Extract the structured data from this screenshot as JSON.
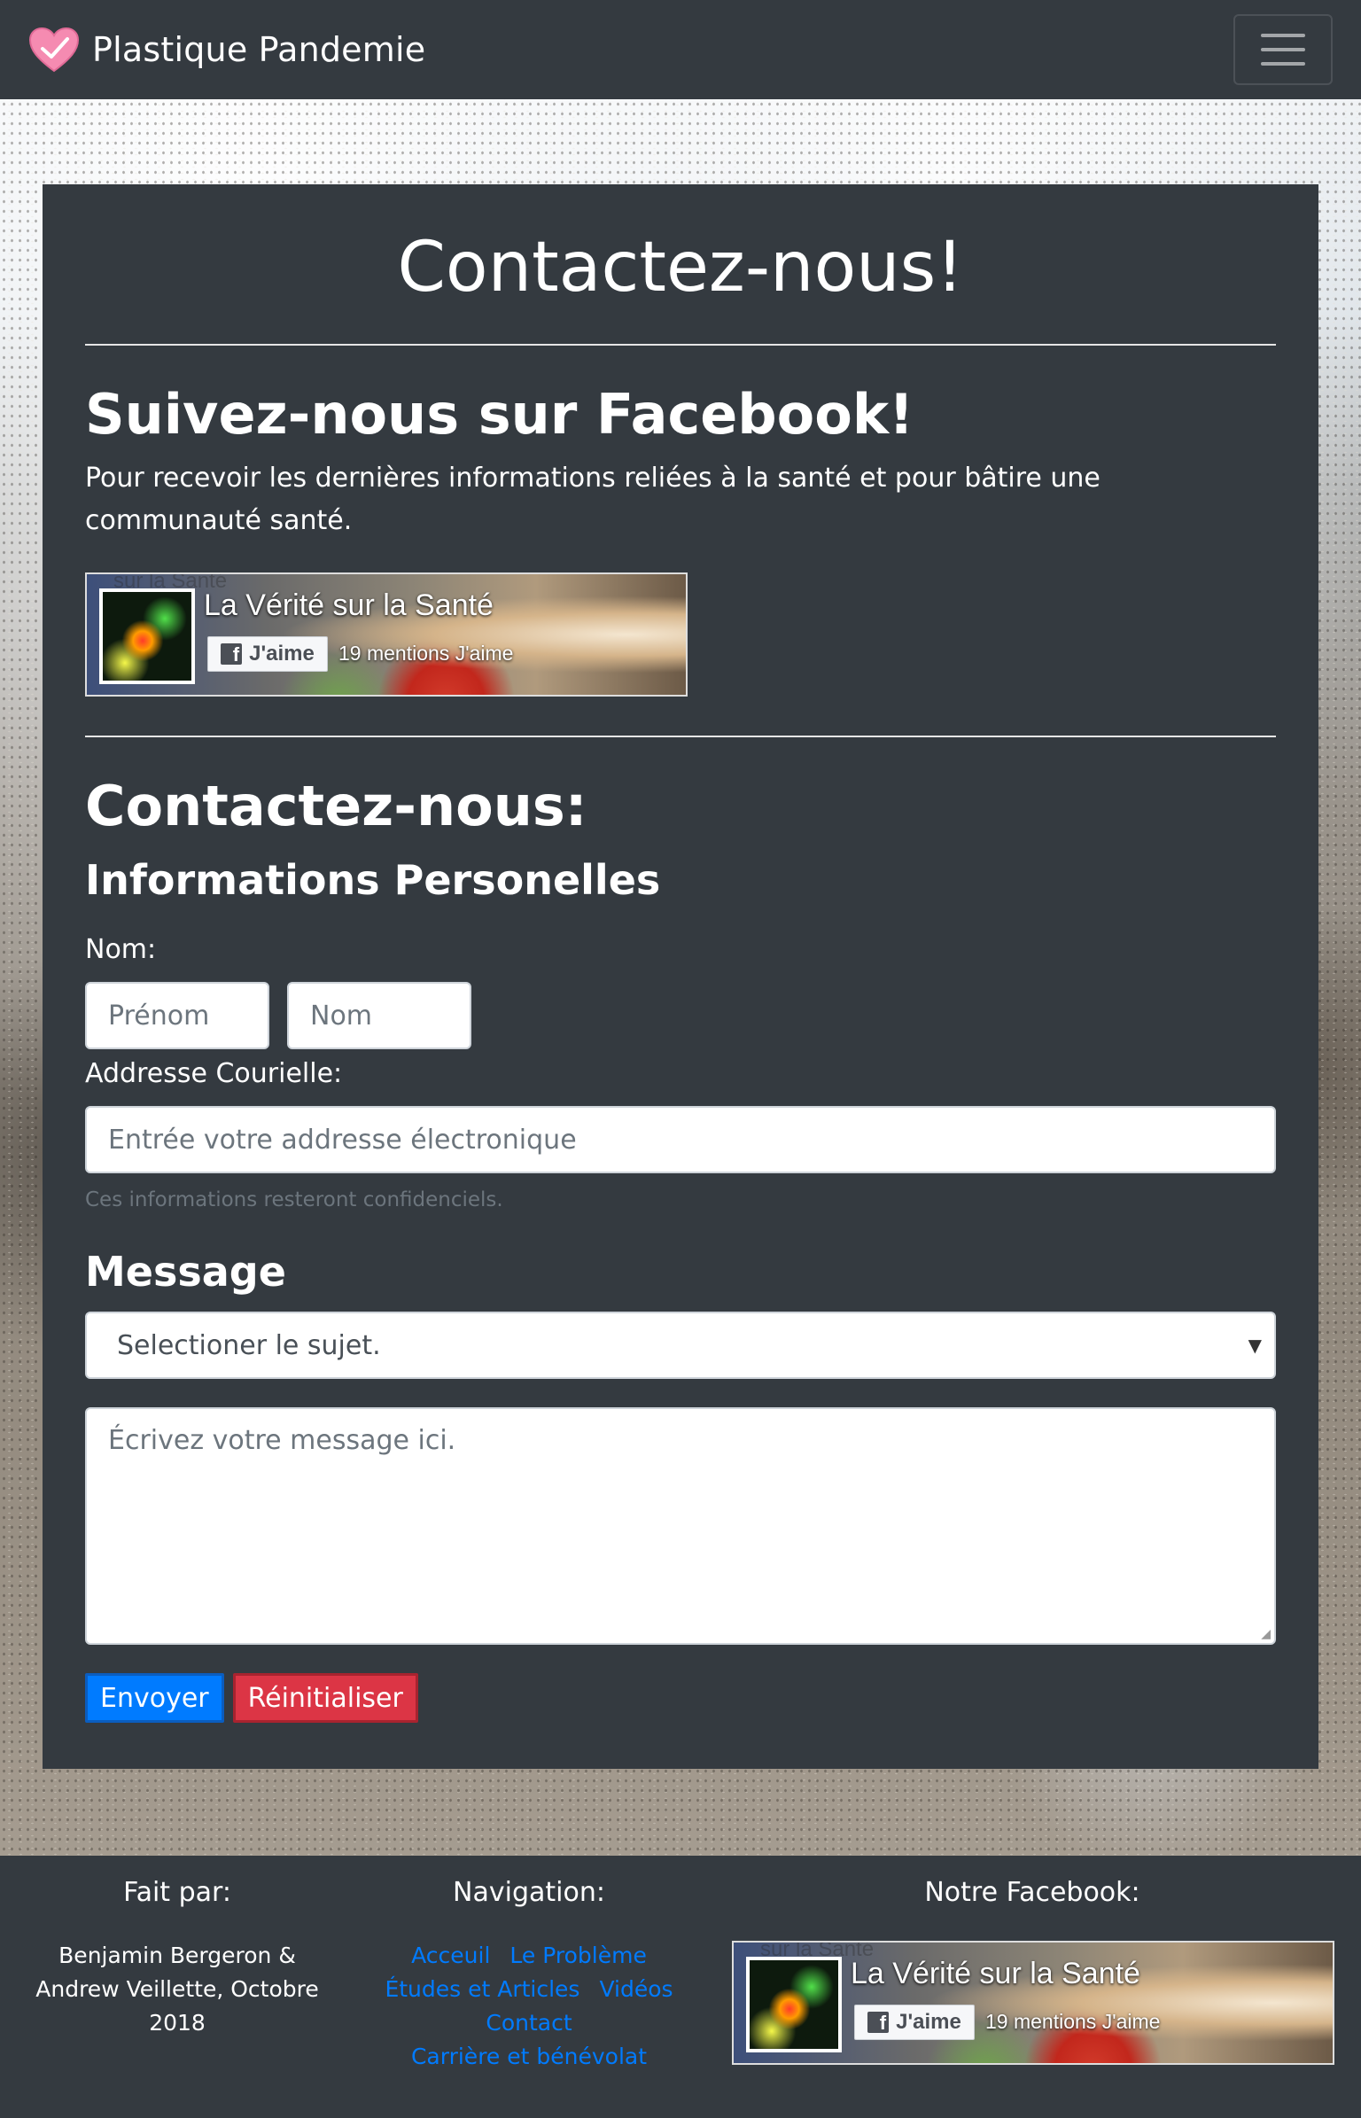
{
  "navbar": {
    "brand": "Plastique Pandemie",
    "toggler_icon": "hamburger-icon"
  },
  "card": {
    "title": "Contactez-nous!",
    "facebook_heading": "Suivez-nous sur Facebook!",
    "facebook_text": "Pour recevoir les dernières informations reliées à la santé et pour bâtire une communauté santé.",
    "contact_heading": "Contactez-nous:",
    "personal_heading": "Informations Personelles",
    "name_label": "Nom:",
    "firstname_placeholder": "Prénom",
    "lastname_placeholder": "Nom",
    "email_label": "Addresse Courielle:",
    "email_placeholder": "Entrée votre addresse électronique",
    "email_help": "Ces informations resteront confidenciels.",
    "message_heading": "Message",
    "subject_selected": "Selectioner le sujet.",
    "message_placeholder": "Écrivez votre message ici.",
    "submit_label": "Envoyer",
    "reset_label": "Réinitialiser"
  },
  "facebook_widget": {
    "ghost_text": "sur la Santé",
    "page_name": "La Vérité sur la Santé",
    "like_label": "J'aime",
    "likes_count": "19 mentions J'aime"
  },
  "footer": {
    "made_by_heading": "Fait par:",
    "credits": "Benjamin Bergeron & Andrew Veillette, Octobre 2018",
    "nav_heading": "Navigation:",
    "nav_links": [
      "Acceuil",
      "Le Problème",
      "Études et Articles",
      "Vidéos",
      "Contact",
      "Carrière et bénévolat"
    ],
    "facebook_heading": "Notre Facebook:"
  },
  "colors": {
    "navbar_bg": "#343a40",
    "primary": "#007bff",
    "danger": "#dc3545"
  }
}
